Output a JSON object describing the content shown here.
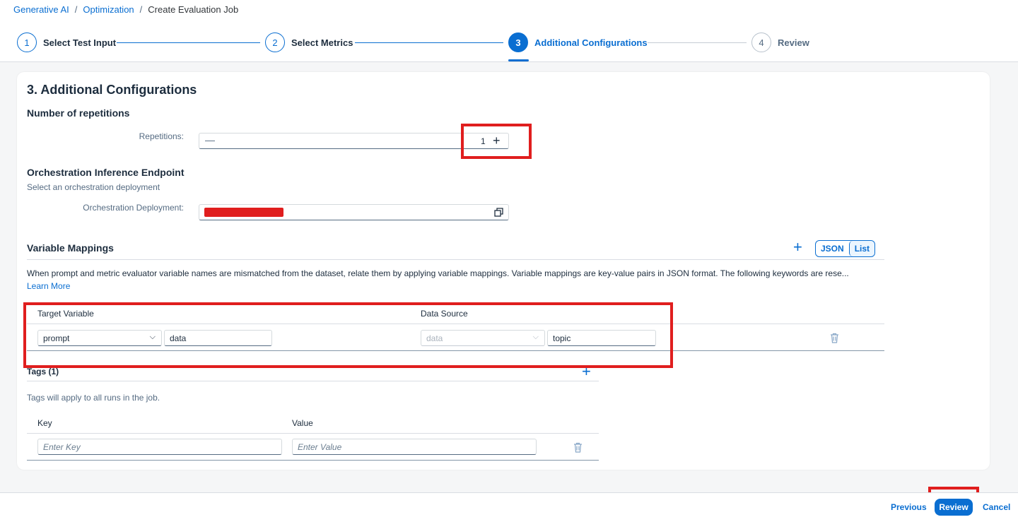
{
  "breadcrumb": {
    "items": [
      "Generative AI",
      "Optimization"
    ],
    "current": "Create Evaluation Job",
    "sep": "/"
  },
  "steps": [
    {
      "num": "1",
      "label": "Select Test Input"
    },
    {
      "num": "2",
      "label": "Select Metrics"
    },
    {
      "num": "3",
      "label": "Additional Configurations"
    },
    {
      "num": "4",
      "label": "Review"
    }
  ],
  "section": {
    "title": "3. Additional Configurations",
    "repetitions": {
      "heading": "Number of repetitions",
      "label": "Repetitions:",
      "minus": "—",
      "value": "1",
      "plus": "+"
    },
    "endpoint": {
      "heading": "Orchestration Inference Endpoint",
      "subtitle": "Select an orchestration deployment",
      "label": "Orchestration Deployment:"
    },
    "variable_mappings": {
      "heading": "Variable Mappings",
      "add": "+",
      "toggle": [
        "JSON",
        "List"
      ],
      "description": "When prompt and metric evaluator variable names are mismatched from the dataset, relate them by applying variable mappings. Variable mappings are key-value pairs in JSON format. The following keywords are rese...",
      "learn_more": "Learn More",
      "columns": [
        "Target Variable",
        "Data Source"
      ],
      "row": {
        "target_select": "prompt",
        "target_input": "data",
        "source_select": "data",
        "source_input": "topic"
      }
    },
    "tags": {
      "heading": "Tags (1)",
      "add": "+",
      "description": "Tags will apply to all runs in the job.",
      "columns": [
        "Key",
        "Value"
      ],
      "key_placeholder": "Enter Key",
      "value_placeholder": "Enter Value"
    }
  },
  "footer": {
    "previous": "Previous",
    "review": "Review",
    "cancel": "Cancel"
  }
}
